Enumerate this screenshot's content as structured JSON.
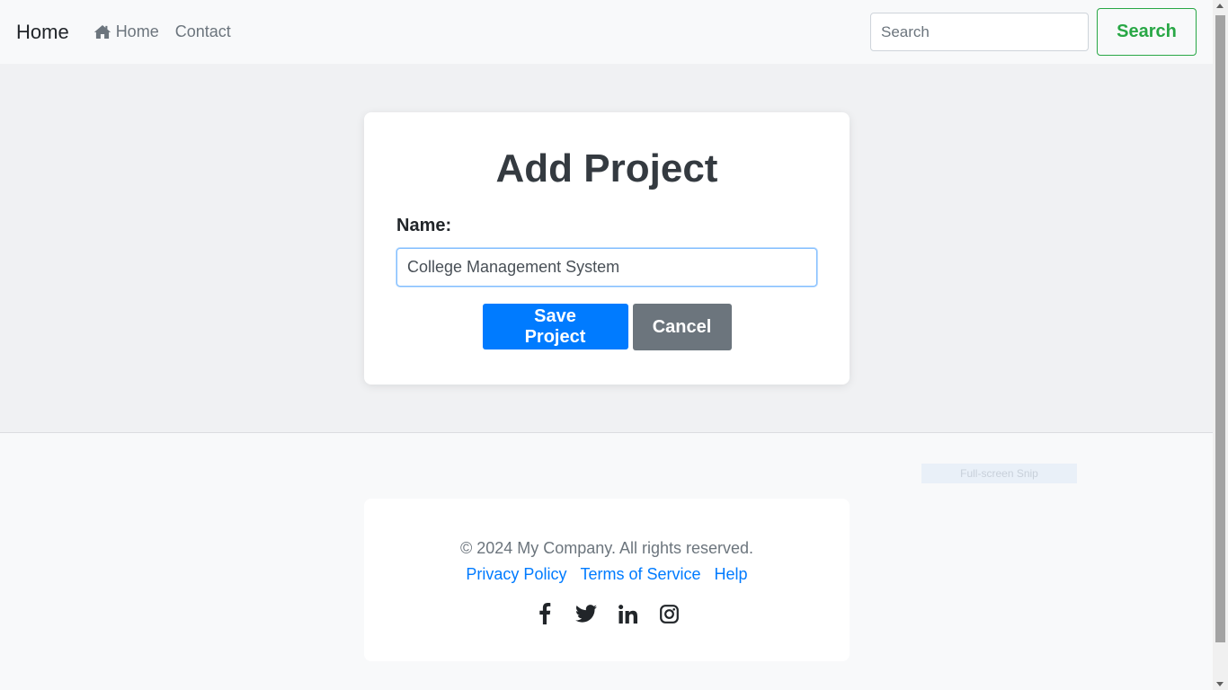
{
  "navbar": {
    "brand": "Home",
    "links": [
      {
        "label": "Home",
        "icon": "home-icon"
      },
      {
        "label": "Contact"
      }
    ],
    "search_placeholder": "Search",
    "search_button": "Search"
  },
  "form": {
    "title": "Add Project",
    "name_label": "Name:",
    "name_value": "College Management System",
    "save_button": "Save Project",
    "cancel_button": "Cancel"
  },
  "overlay": {
    "snip_label": "Full-screen Snip"
  },
  "footer": {
    "copyright": "© 2024 My Company. All rights reserved.",
    "links": [
      "Privacy Policy",
      "Terms of Service",
      "Help"
    ],
    "socials": [
      "facebook-icon",
      "twitter-icon",
      "linkedin-icon",
      "instagram-icon"
    ]
  },
  "colors": {
    "primary": "#007bff",
    "secondary": "#6c757d",
    "success": "#28a745"
  }
}
